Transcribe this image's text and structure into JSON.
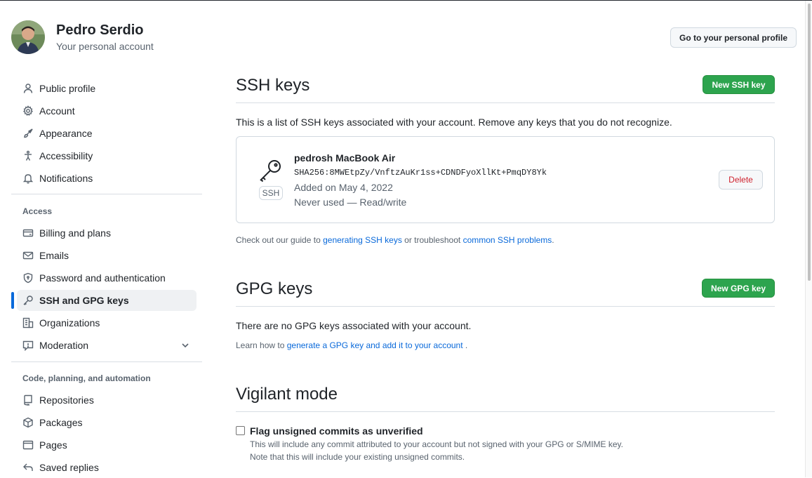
{
  "profile": {
    "name": "Pedro Serdio",
    "subtitle": "Your personal account",
    "go_profile_label": "Go to your personal profile"
  },
  "sidebar": {
    "items_top": [
      {
        "label": "Public profile",
        "icon": "person-icon"
      },
      {
        "label": "Account",
        "icon": "gear-icon"
      },
      {
        "label": "Appearance",
        "icon": "paintbrush-icon"
      },
      {
        "label": "Accessibility",
        "icon": "accessibility-icon"
      },
      {
        "label": "Notifications",
        "icon": "bell-icon"
      }
    ],
    "access_heading": "Access",
    "items_access": [
      {
        "label": "Billing and plans",
        "icon": "credit-card-icon"
      },
      {
        "label": "Emails",
        "icon": "mail-icon"
      },
      {
        "label": "Password and authentication",
        "icon": "shield-lock-icon"
      },
      {
        "label": "SSH and GPG keys",
        "icon": "key-icon",
        "active": true
      },
      {
        "label": "Organizations",
        "icon": "organization-icon"
      },
      {
        "label": "Moderation",
        "icon": "report-icon",
        "expandable": true
      }
    ],
    "code_heading": "Code, planning, and automation",
    "items_code": [
      {
        "label": "Repositories",
        "icon": "repo-icon"
      },
      {
        "label": "Packages",
        "icon": "package-icon"
      },
      {
        "label": "Pages",
        "icon": "browser-icon"
      },
      {
        "label": "Saved replies",
        "icon": "reply-icon"
      }
    ]
  },
  "ssh": {
    "title": "SSH keys",
    "new_button": "New SSH key",
    "description": "This is a list of SSH keys associated with your account. Remove any keys that you do not recognize.",
    "key": {
      "badge": "SSH",
      "name": "pedrosh MacBook Air",
      "fingerprint": "SHA256:8MWEtpZy/VnftzAuKr1ss+CDNDFyoXllKt+PmqDY8Yk",
      "added": "Added on May 4, 2022",
      "usage": "Never used — Read/write",
      "delete_label": "Delete"
    },
    "guide_prefix": "Check out our guide to",
    "guide_link1": "generating SSH keys",
    "guide_middle": "or troubleshoot",
    "guide_link2": "common SSH problems",
    "guide_suffix": "."
  },
  "gpg": {
    "title": "GPG keys",
    "new_button": "New GPG key",
    "empty_text": "There are no GPG keys associated with your account.",
    "learn_prefix": "Learn how to",
    "learn_link": "generate a GPG key and add it to your account",
    "learn_suffix": "."
  },
  "vigilant": {
    "title": "Vigilant mode",
    "checkbox_label": "Flag unsigned commits as unverified",
    "checked": false,
    "note1": "This will include any commit attributed to your account but not signed with your GPG or S/MIME key.",
    "note2": "Note that this will include your existing unsigned commits."
  },
  "colors": {
    "accent": "#0969da",
    "primary_button": "#2da44e",
    "danger": "#cf222e"
  }
}
